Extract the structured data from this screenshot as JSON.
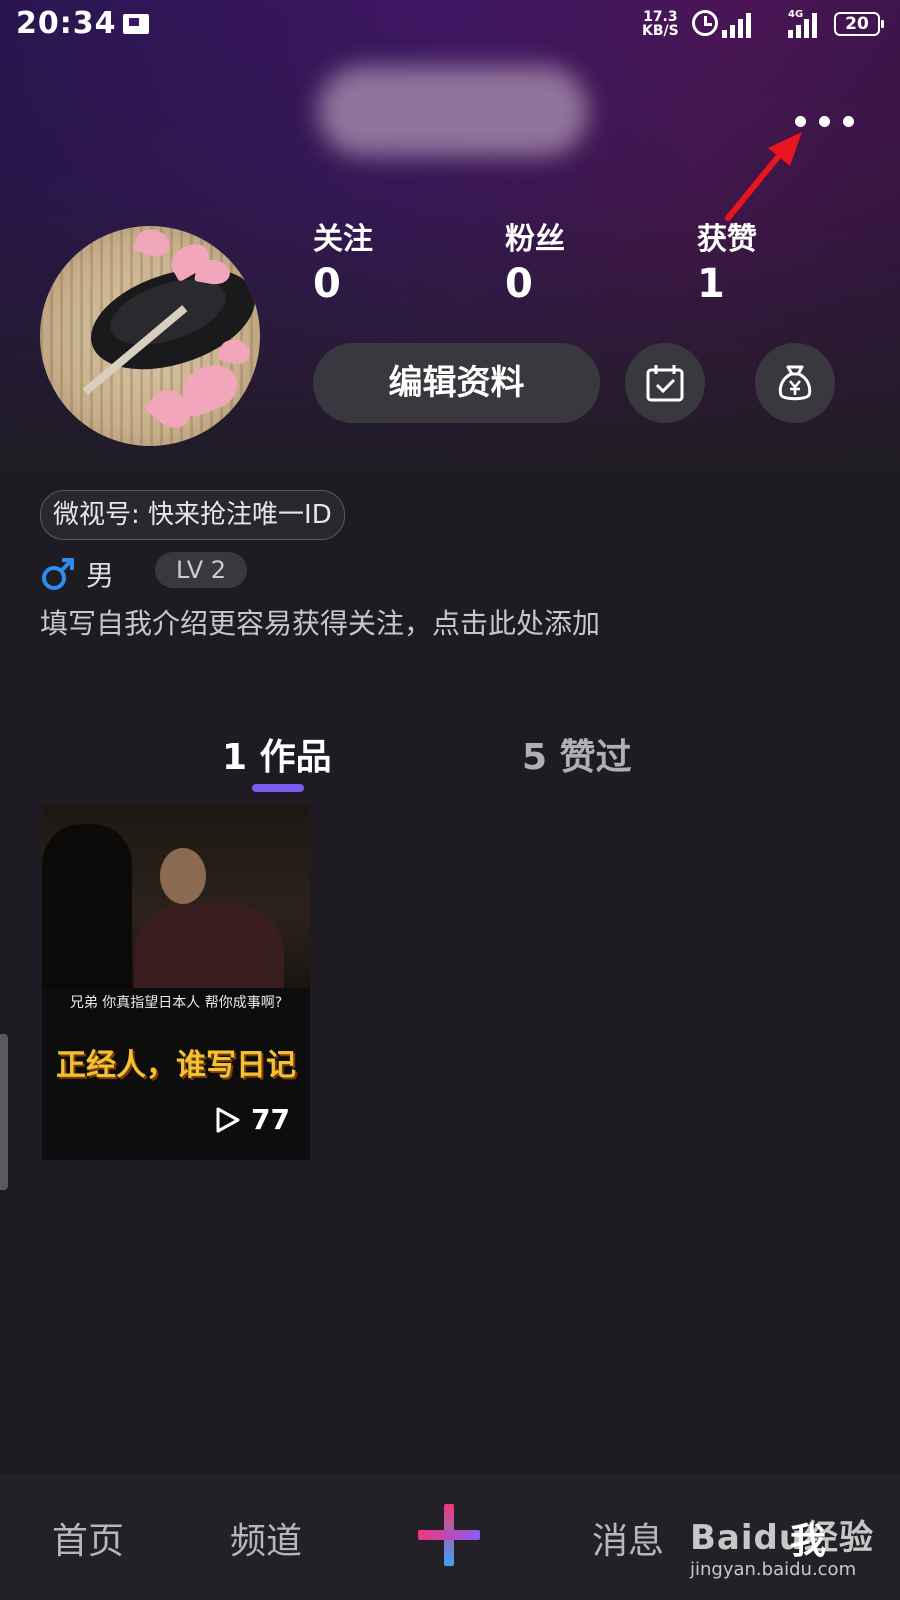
{
  "status_bar": {
    "time": "20:34",
    "speed_value": "17.3",
    "speed_unit": "KB/S",
    "network": "4G",
    "battery": "20"
  },
  "profile": {
    "stats": [
      {
        "label": "关注",
        "value": "0"
      },
      {
        "label": "粉丝",
        "value": "0"
      },
      {
        "label": "获赞",
        "value": "1"
      }
    ],
    "edit_button": "编辑资料",
    "weishi_id": "微视号: 快来抢注唯一ID",
    "gender": "男",
    "level": "LV 2",
    "bio_placeholder": "填写自我介绍更容易获得关注，点击此处添加"
  },
  "tabs": [
    {
      "label": "1 作品",
      "active": true
    },
    {
      "label": "5 赞过",
      "active": false
    }
  ],
  "videos": [
    {
      "caption_top": "兄弟 你真指望日本人 帮你成事啊?",
      "caption_main": "正经人，谁写日记",
      "views": "77"
    }
  ],
  "bottom_nav": [
    {
      "label": "首页"
    },
    {
      "label": "频道"
    },
    {
      "label": "消息"
    },
    {
      "label": "我"
    }
  ],
  "watermark": {
    "logo": "Baidu经验",
    "url": "jingyan.baidu.com"
  },
  "colors": {
    "accent": "#7c5cf0",
    "background": "#1e1c22",
    "arrow": "#e8141e"
  }
}
